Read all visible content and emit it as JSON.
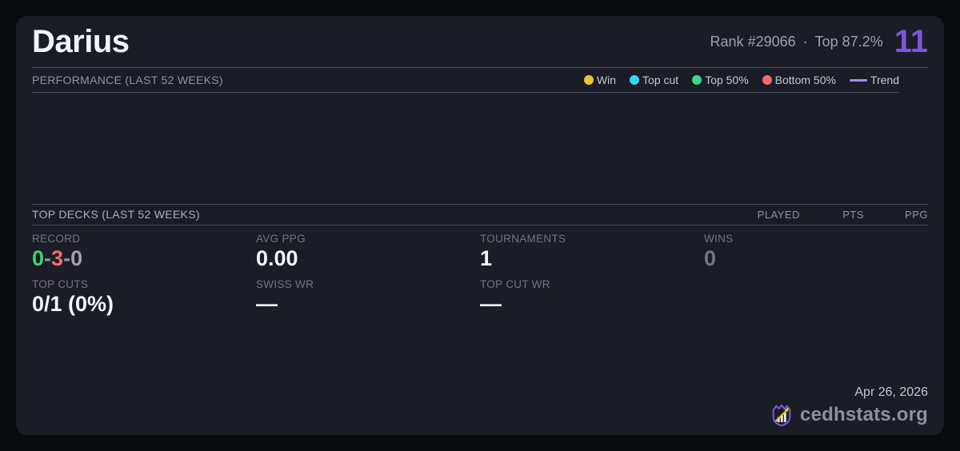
{
  "colors": {
    "page_bg": "#0a0b0e",
    "card_bg": "#1a1d25",
    "divider": "#414856",
    "accent": "#7c55e0",
    "win": "#f2c338",
    "top_cut": "#33d6ef",
    "top50": "#3dd68c",
    "bottom50": "#f56b6b",
    "trend": "#a78bfa",
    "green": "#3ecf74",
    "red": "#f56b6b",
    "text_bright": "#f3f5f8",
    "text_muted": "#8b93a3",
    "text_muted2": "#99a1b1",
    "text_dim": "#6e7585"
  },
  "header": {
    "title": "Darius",
    "rank": "Rank #29066",
    "separator": "·",
    "percentile": "Top 87.2%",
    "count": "11"
  },
  "performance": {
    "heading": "PERFORMANCE (LAST 52 WEEKS)",
    "legend": [
      {
        "label": "Win",
        "swatch": "dot",
        "color_key": "win"
      },
      {
        "label": "Top cut",
        "swatch": "dot",
        "color_key": "top_cut"
      },
      {
        "label": "Top 50%",
        "swatch": "dot",
        "color_key": "top50"
      },
      {
        "label": "Bottom 50%",
        "swatch": "dot",
        "color_key": "bottom50"
      },
      {
        "label": "Trend",
        "swatch": "line",
        "color_key": "trend"
      }
    ]
  },
  "chart_data": {
    "type": "scatter",
    "title": "PERFORMANCE (LAST 52 WEEKS)",
    "series": [],
    "values": [],
    "legend_position": "top-right",
    "grid": false
  },
  "top_decks": {
    "heading": "TOP DECKS (LAST 52 WEEKS)",
    "columns": [
      "PLAYED",
      "PTS",
      "PPG"
    ],
    "rows": []
  },
  "stats": {
    "record": {
      "label": "RECORD",
      "wins": "0",
      "losses": "3",
      "draws": "0",
      "separator": "-"
    },
    "avg_ppg": {
      "label": "AVG PPG",
      "value": "0.00"
    },
    "tournaments": {
      "label": "TOURNAMENTS",
      "value": "1"
    },
    "wins": {
      "label": "WINS",
      "value": "0"
    },
    "top_cuts": {
      "label": "TOP CUTS",
      "value": "0/1 (0%)"
    },
    "swiss_wr": {
      "label": "SWISS WR",
      "value": "—"
    },
    "top_cut_wr": {
      "label": "TOP CUT WR",
      "value": "—"
    }
  },
  "footer": {
    "date": "Apr 26, 2026",
    "brand": "cedhstats.org"
  }
}
